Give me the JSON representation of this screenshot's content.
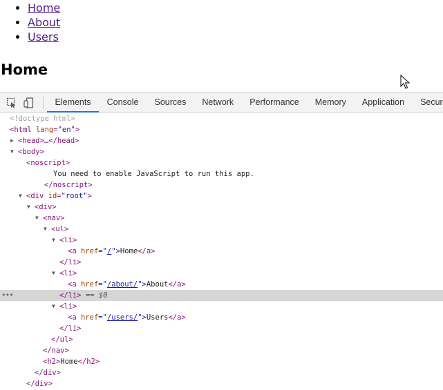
{
  "page": {
    "nav": [
      {
        "label": "Home"
      },
      {
        "label": "About"
      },
      {
        "label": "Users"
      }
    ],
    "heading": "Home"
  },
  "devtools": {
    "tabs": [
      {
        "label": "Elements",
        "active": true
      },
      {
        "label": "Console"
      },
      {
        "label": "Sources"
      },
      {
        "label": "Network"
      },
      {
        "label": "Performance"
      },
      {
        "label": "Memory"
      },
      {
        "label": "Application"
      },
      {
        "label": "Security"
      }
    ],
    "tree": {
      "doctype": "<!doctype html>",
      "html_open": "<html",
      "lang_attr": "lang",
      "lang_val": "\"en\"",
      "close": ">",
      "head": "<head>…</head>",
      "body_open": "<body>",
      "noscript_open": "<noscript>",
      "noscript_text": "You need to enable JavaScript to run this app.",
      "noscript_close": "</noscript>",
      "div_root_open": "<div",
      "id_attr": "id",
      "id_val": "\"root\"",
      "div_open": "<div>",
      "nav_open": "<nav>",
      "ul_open": "<ul>",
      "li_open": "<li>",
      "a_open": "<a",
      "href_attr": "href",
      "eq_quote": "=\"",
      "quote_close": "\">",
      "a_close": "</a>",
      "li_close": "</li>",
      "links": [
        {
          "href": "/",
          "text": "Home"
        },
        {
          "href": "/about/",
          "text": "About"
        },
        {
          "href": "/users/",
          "text": "Users"
        }
      ],
      "selected_marker": "== $0",
      "ul_close": "</ul>",
      "nav_close": "</nav>",
      "h2_open": "<h2>",
      "h2_text": "Home",
      "h2_close": "</h2>",
      "div_close": "</div>"
    }
  }
}
